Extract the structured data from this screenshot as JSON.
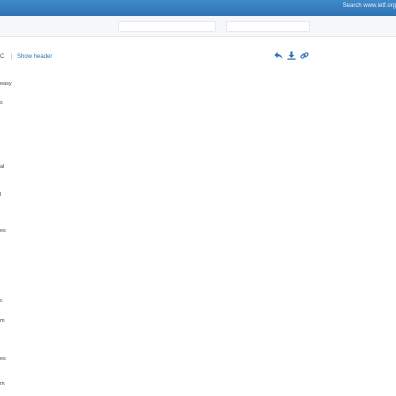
{
  "topbar": {
    "search_link": "Search www.ietf.org"
  },
  "message_header": {
    "left_fragment": "C",
    "separator": "|",
    "show_header_label": "Show header"
  },
  "icons": {
    "reply": "reply-icon",
    "download": "download-icon",
    "link": "link-icon"
  },
  "body_fragments": [
    "easy",
    "s",
    "al",
    "l",
    "es",
    "c",
    "m",
    "es",
    "m"
  ],
  "colors": {
    "topbar": "#2f73b3",
    "link": "#2f73b3"
  }
}
